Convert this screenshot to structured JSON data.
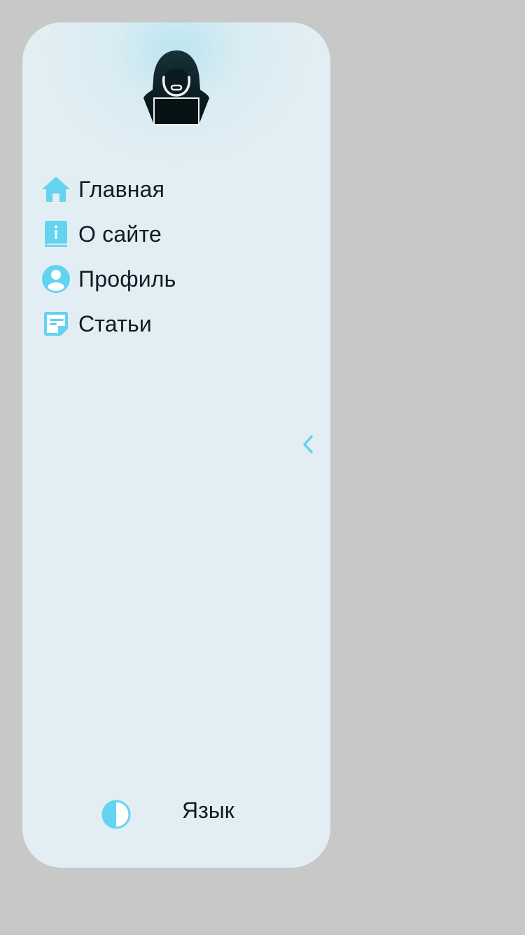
{
  "sidebar": {
    "logo_icon": "hooded-hacker-icon",
    "accent_color": "#63d3f0",
    "items": [
      {
        "label": "Главная",
        "icon": "home-icon"
      },
      {
        "label": "О сайте",
        "icon": "info-book-icon"
      },
      {
        "label": "Профиль",
        "icon": "user-circle-icon"
      },
      {
        "label": "Статьи",
        "icon": "note-icon"
      }
    ],
    "collapse_icon": "chevron-left-icon",
    "footer": {
      "theme_icon": "contrast-icon",
      "language_label": "Язык"
    }
  }
}
